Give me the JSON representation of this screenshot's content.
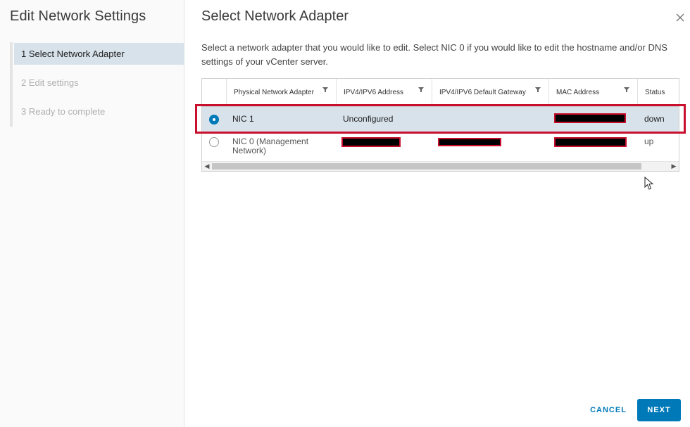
{
  "sidebar": {
    "title": "Edit Network Settings",
    "steps": [
      {
        "label": "1 Select Network Adapter",
        "active": true
      },
      {
        "label": "2 Edit settings",
        "active": false
      },
      {
        "label": "3 Ready to complete",
        "active": false
      }
    ]
  },
  "main": {
    "title": "Select Network Adapter",
    "description": "Select a network adapter that you would like to edit. Select NIC 0 if you would like to edit the hostname and/or DNS settings of your vCenter server."
  },
  "table": {
    "columns": [
      "Physical Network Adapter",
      "IPV4/IPV6 Address",
      "IPV4/IPV6 Default Gateway",
      "MAC Address",
      "Status"
    ],
    "rows": [
      {
        "adapter": "NIC 1",
        "address": "Unconfigured",
        "status": "down",
        "selected": true
      },
      {
        "adapter": "NIC 0 (Management Network)",
        "status": "up",
        "selected": false
      }
    ]
  },
  "footer": {
    "cancel_label": "CANCEL",
    "next_label": "NEXT"
  },
  "colors": {
    "accent": "#0079b8",
    "selected_row": "#d8e2ea",
    "highlight": "#c8102e"
  }
}
